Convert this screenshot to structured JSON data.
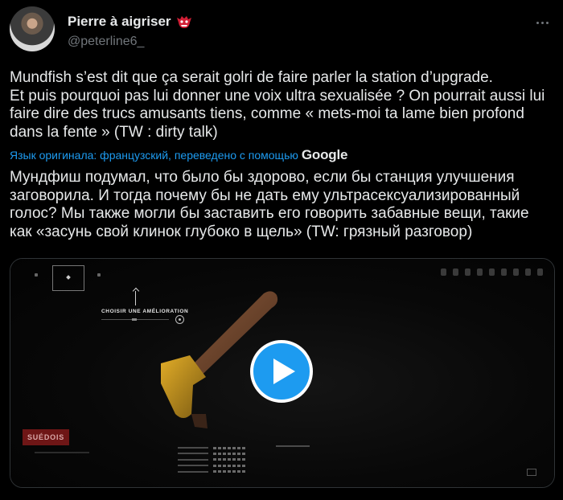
{
  "tweet": {
    "display_name": "Pierre à aigriser",
    "handle": "@peterline6_",
    "text": "Mundfish s’est dit que ça serait golri de faire parler la station d’upgrade.\nEt puis pourquoi pas lui donner une voix ultra sexualisée ? On pourrait aussi lui faire dire des trucs amusants tiens, comme « mets-moi ta lame bien profond dans la fente » (TW : dirty talk)",
    "translation_notice": "Язык оригинала: французский, переведено с помощью",
    "translation_provider": "Google",
    "translated_text": "Мундфиш подумал, что было бы здорово, если бы станция улучшения заговорила. И тогда почему бы не дать ему ультрасексуализированный голос? Мы также могли бы заставить его говорить забавные вещи, такие как «засунь свой клинок глубоко в щель» (TW: грязный разговор)"
  },
  "media": {
    "type": "video",
    "overlay_label": "CHOISIR UNE AMÉLIORATION",
    "badge_label": "SUÉDOIS",
    "play_icon": "play-icon"
  },
  "colors": {
    "accent": "#1d9bf0",
    "background": "#000000",
    "text": "#e7e9ea",
    "muted": "#71767b",
    "badge_bg": "#6e1616"
  }
}
